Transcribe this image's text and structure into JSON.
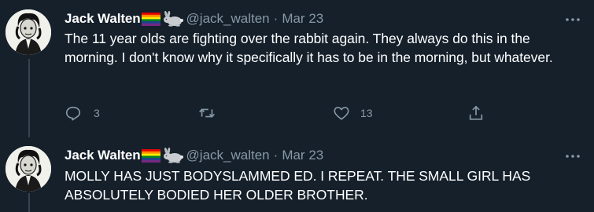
{
  "colors": {
    "background": "#15202b",
    "text_primary": "#ffffff",
    "text_secondary": "#8899a6",
    "thread_line": "#38444d"
  },
  "tweets": [
    {
      "author_name": "Jack Walten",
      "emoji": [
        "rainbow-flag-emoji",
        "rabbit-emoji"
      ],
      "handle": "@jack_walten",
      "separator": "·",
      "date": "Mar 23",
      "text": "The 11 year olds are fighting over the rabbit again. They always do this in the morning. I don't know why it specifically it has to be in the morning, but whatever.",
      "actions": {
        "reply_icon": "reply-icon",
        "reply_count": "3",
        "retweet_icon": "retweet-icon",
        "like_icon": "heart-icon",
        "like_count": "13",
        "share_icon": "share-icon"
      }
    },
    {
      "author_name": "Jack Walten",
      "emoji": [
        "rainbow-flag-emoji",
        "rabbit-emoji"
      ],
      "handle": "@jack_walten",
      "separator": "·",
      "date": "Mar 23",
      "text": "MOLLY HAS JUST BODYSLAMMED ED. I REPEAT. THE SMALL GIRL HAS ABSOLUTELY BODIED HER OLDER BROTHER."
    }
  ]
}
